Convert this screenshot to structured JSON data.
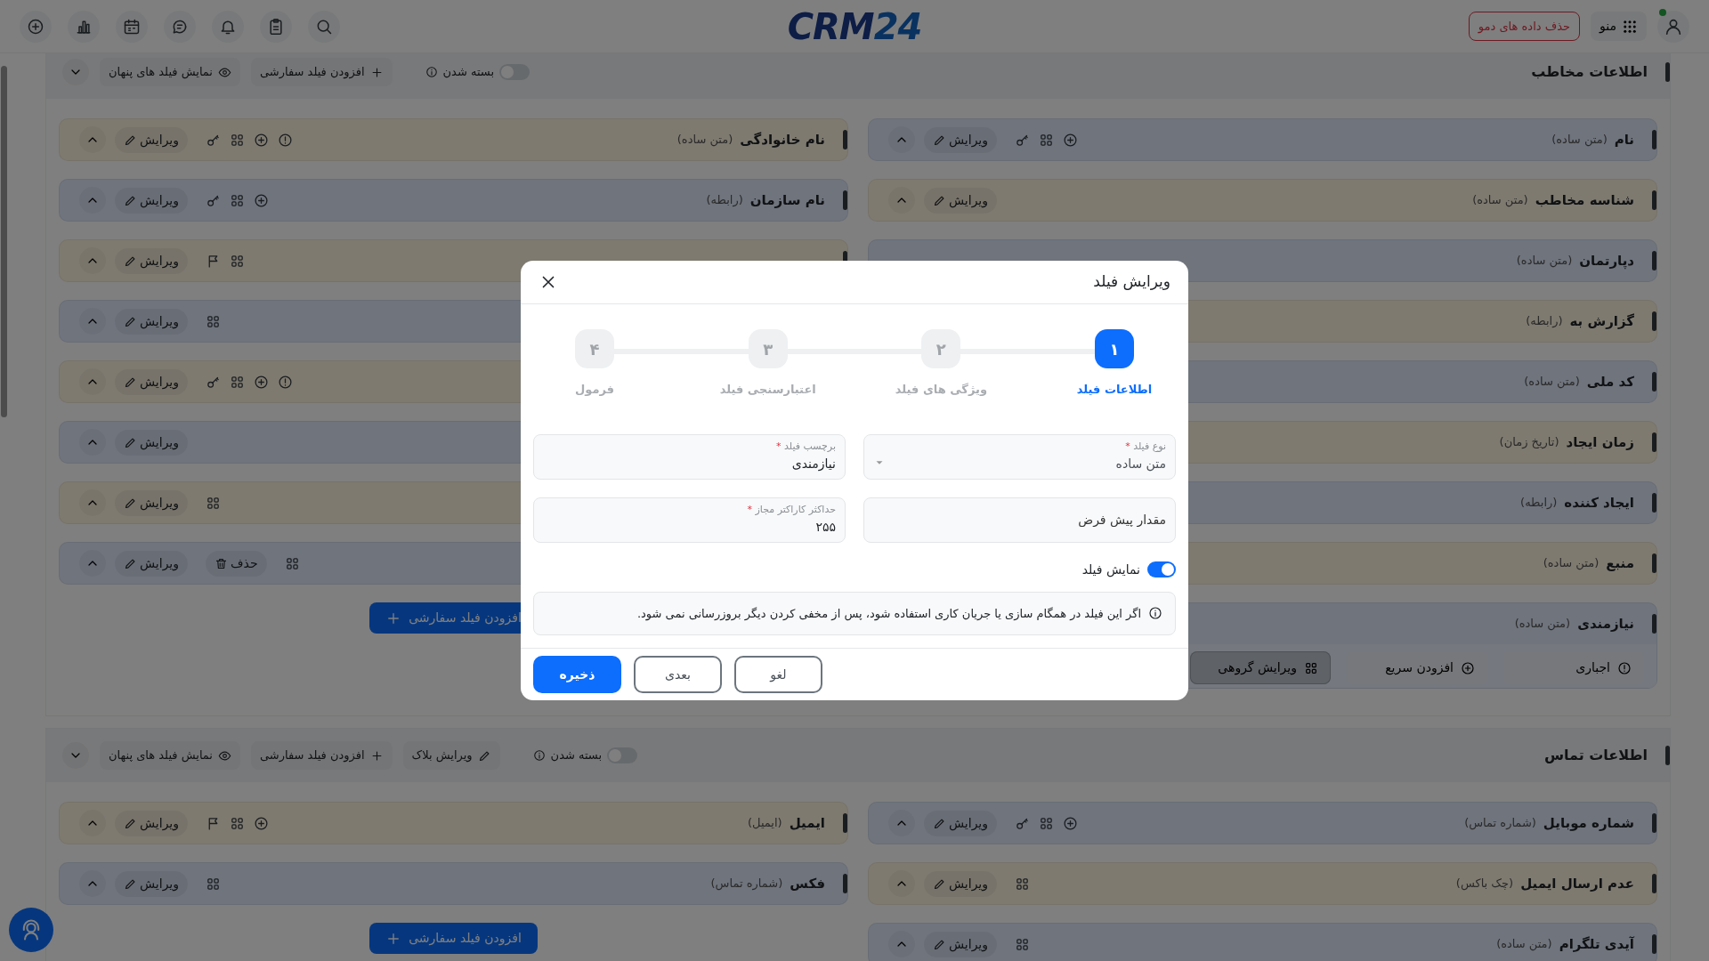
{
  "topbar": {
    "logo_text": "CRM",
    "logo_number": "24",
    "menu_label": "منو",
    "demo_button": "حذف داده های دمو"
  },
  "sections": [
    {
      "title": "اطلاعات مخاطب",
      "collapse_label": "بسته شدن",
      "collapsed": false,
      "actions": [
        {
          "kind": "add",
          "label": "افزودن فیلد سفارشی"
        },
        {
          "kind": "hidden",
          "label": "نمایش فیلد های پنهان"
        }
      ],
      "add_button": "افزودن فیلد سفارشی",
      "columns": [
        [
          {
            "name": "نام",
            "type": "(متن ساده)",
            "tools": [
              {
                "kind": "add"
              },
              {
                "kind": "grid"
              },
              {
                "kind": "key"
              }
            ],
            "edit": "ویرایش"
          },
          {
            "name": "شناسه مخاطب",
            "type": "(متن ساده)",
            "edit": "ویرایش"
          },
          {
            "name": "دپارتمان",
            "type": "(متن ساده)"
          },
          {
            "name": "گزارش به",
            "type": "(رابطه)"
          },
          {
            "name": "کد ملی",
            "type": "(متن ساده)"
          },
          {
            "name": "زمان ایجاد",
            "type": "(تاریخ زمان)"
          },
          {
            "name": "ایجاد کننده",
            "type": "(رابطه)"
          },
          {
            "name": "منبع",
            "type": "(متن ساده)"
          },
          {
            "name": "نیازمندی",
            "type": "(متن ساده)",
            "footer": [
              {
                "kind": "required",
                "label": "اجباری",
                "selected": false
              },
              {
                "kind": "quick_add",
                "label": "افزودن سریع",
                "selected": false
              },
              {
                "kind": "group_edit",
                "label": "ویرایش گروهی",
                "selected": true
              }
            ]
          }
        ],
        [
          {
            "name": "نام خانوادگی",
            "type": "(متن ساده)",
            "tools": [
              {
                "kind": "info"
              },
              {
                "kind": "add"
              },
              {
                "kind": "grid"
              },
              {
                "kind": "key"
              }
            ],
            "edit": "ویرایش"
          },
          {
            "name": "نام سازمان",
            "type": "(رابطه)",
            "tools": [
              {
                "kind": "add"
              },
              {
                "kind": "grid"
              },
              {
                "kind": "key"
              }
            ],
            "edit": "ویرایش"
          },
          {
            "tools": [
              {
                "kind": "grid"
              },
              {
                "kind": "flag"
              }
            ],
            "edit": "ویرایش"
          },
          {
            "tools": [
              {
                "kind": "grid"
              }
            ],
            "edit": "ویرایش"
          },
          {
            "tools": [
              {
                "kind": "info"
              },
              {
                "kind": "add"
              },
              {
                "kind": "grid"
              },
              {
                "kind": "key"
              }
            ],
            "edit": "ویرایش"
          },
          {
            "edit": "ویرایش"
          },
          {
            "tools": [
              {
                "kind": "grid"
              }
            ],
            "edit": "ویرایش"
          },
          {
            "tools": [
              {
                "kind": "grid"
              }
            ],
            "delete": "حذف",
            "edit": "ویرایش"
          }
        ]
      ]
    },
    {
      "title": "اطلاعات تماس",
      "collapse_label": "بسته شدن",
      "collapsed": false,
      "actions": [
        {
          "kind": "edit",
          "label": "ویرایش بلاک"
        },
        {
          "kind": "add",
          "label": "افزودن فیلد سفارشی"
        },
        {
          "kind": "hidden",
          "label": "نمایش فیلد های پنهان"
        }
      ],
      "add_button": "افزودن فیلد سفارشی",
      "columns": [
        [
          {
            "name": "شماره موبایل",
            "type": "(شماره تماس)",
            "tools": [
              {
                "kind": "add"
              },
              {
                "kind": "grid"
              },
              {
                "kind": "key"
              }
            ],
            "edit": "ویرایش"
          },
          {
            "name": "عدم ارسال ایمیل",
            "type": "(چک باکس)",
            "tools": [
              {
                "kind": "grid"
              }
            ],
            "edit": "ویرایش"
          },
          {
            "name": "آیدی تلگرام",
            "type": "(متن ساده)",
            "tools": [
              {
                "kind": "grid"
              }
            ],
            "edit": "ویرایش"
          }
        ],
        [
          {
            "name": "ایمیل",
            "type": "(ایمیل)",
            "tools": [
              {
                "kind": "add"
              },
              {
                "kind": "grid"
              },
              {
                "kind": "flag"
              }
            ],
            "edit": "ویرایش"
          },
          {
            "name": "فکس",
            "type": "(شماره تماس)",
            "tools": [
              {
                "kind": "grid"
              }
            ],
            "edit": "ویرایش"
          }
        ]
      ]
    }
  ],
  "modal": {
    "title": "ویرایش فیلد",
    "steps": [
      {
        "number": "۱",
        "label": "اطلاعات فیلد",
        "selected": true
      },
      {
        "number": "۲",
        "label": "ویژگی های فیلد",
        "selected": false
      },
      {
        "number": "۳",
        "label": "اعتبارسنجی فیلد",
        "selected": false
      },
      {
        "number": "۴",
        "label": "فرمول",
        "selected": false
      }
    ],
    "fields": [
      {
        "kind": "select",
        "label": "نوع فیلد",
        "required_mark": "*",
        "value": "متن ساده"
      },
      {
        "kind": "text",
        "placeholder": "مقدار پیش فرض"
      },
      {
        "kind": "text",
        "label": "برچسب فیلد",
        "required_mark": "*",
        "value": "نیازمندی"
      },
      {
        "kind": "text",
        "label": "حداکثر کاراکتر مجاز",
        "required_mark": "*",
        "value": "۲۵۵"
      }
    ],
    "display": {
      "label": "نمایش فیلد",
      "on": true
    },
    "note": "اگر این فیلد در همگام سازی یا جریان کاری استفاده شود، پس از مخفی کردن دیگر بروزرسانی نمی شود.",
    "buttons": [
      {
        "kind": "cancel",
        "label": "لغو"
      },
      {
        "kind": "next",
        "label": "بعدی"
      },
      {
        "kind": "save",
        "label": "ذخیره"
      }
    ]
  }
}
